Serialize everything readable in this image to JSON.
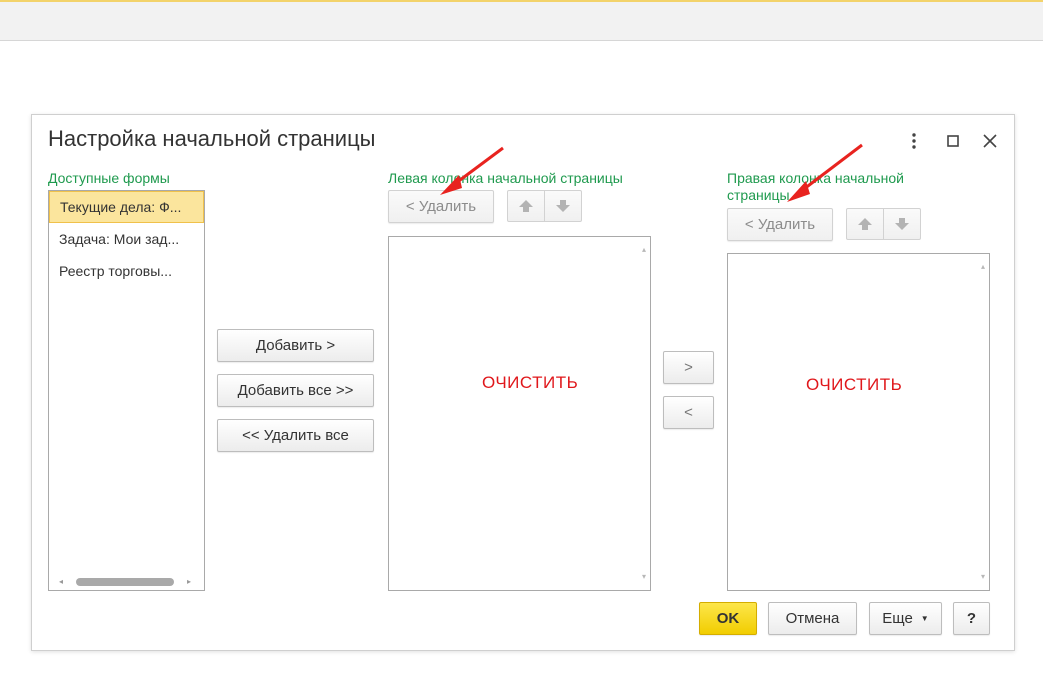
{
  "dialog": {
    "title": "Настройка начальной страницы"
  },
  "available": {
    "label": "Доступные формы",
    "items": [
      "Текущие дела: Ф...",
      "Задача: Мои зад...",
      "Реестр торговы..."
    ],
    "selected_index": 0
  },
  "middle_buttons": {
    "add": "Добавить >",
    "add_all": "Добавить все >>",
    "remove_all": "<< Удалить все"
  },
  "left_column": {
    "label": "Левая колонка начальной страницы",
    "remove_label": "< Удалить",
    "overlay_text": "ОЧИСТИТЬ"
  },
  "transfer": {
    "right": ">",
    "left": "<"
  },
  "right_column": {
    "label_line1": "Правая колонка начальной",
    "label_line2": "страницы",
    "remove_label": "< Удалить",
    "overlay_text": "ОЧИСТИТЬ"
  },
  "footer": {
    "ok": "OK",
    "cancel": "Отмена",
    "more": "Еще",
    "help": "?"
  },
  "colors": {
    "accent_green": "#1f9a4e",
    "overlay_red": "#e0171b",
    "ok_yellow": "#f1cd00",
    "selection": "#fbe59d"
  }
}
